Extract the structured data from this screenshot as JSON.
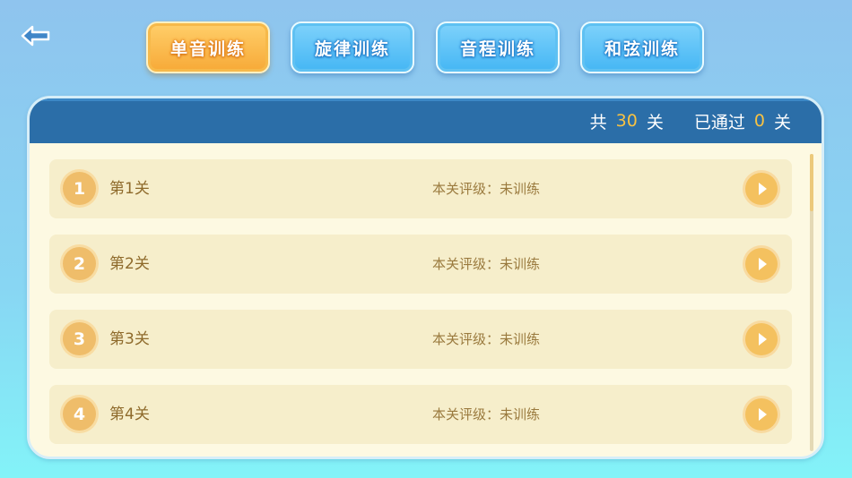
{
  "nav": {
    "back_icon": "arrow-left-icon"
  },
  "tabs": [
    {
      "label": "单音训练",
      "active": true
    },
    {
      "label": "旋律训练",
      "active": false
    },
    {
      "label": "音程训练",
      "active": false
    },
    {
      "label": "和弦训练",
      "active": false
    }
  ],
  "header": {
    "total_prefix": "共",
    "total_count": "30",
    "total_suffix": "关",
    "passed_prefix": "已通过",
    "passed_count": "0",
    "passed_suffix": "关"
  },
  "levels": [
    {
      "number": "1",
      "name": "第1关",
      "rating": "本关评级：未训练"
    },
    {
      "number": "2",
      "name": "第2关",
      "rating": "本关评级：未训练"
    },
    {
      "number": "3",
      "name": "第3关",
      "rating": "本关评级：未训练"
    },
    {
      "number": "4",
      "name": "第4关",
      "rating": "本关评级：未训练"
    }
  ],
  "colors": {
    "accent_orange": "#f7a937",
    "tab_blue": "#44b6f4",
    "header_blue": "#2b6ea8",
    "count_yellow": "#f7c243"
  }
}
